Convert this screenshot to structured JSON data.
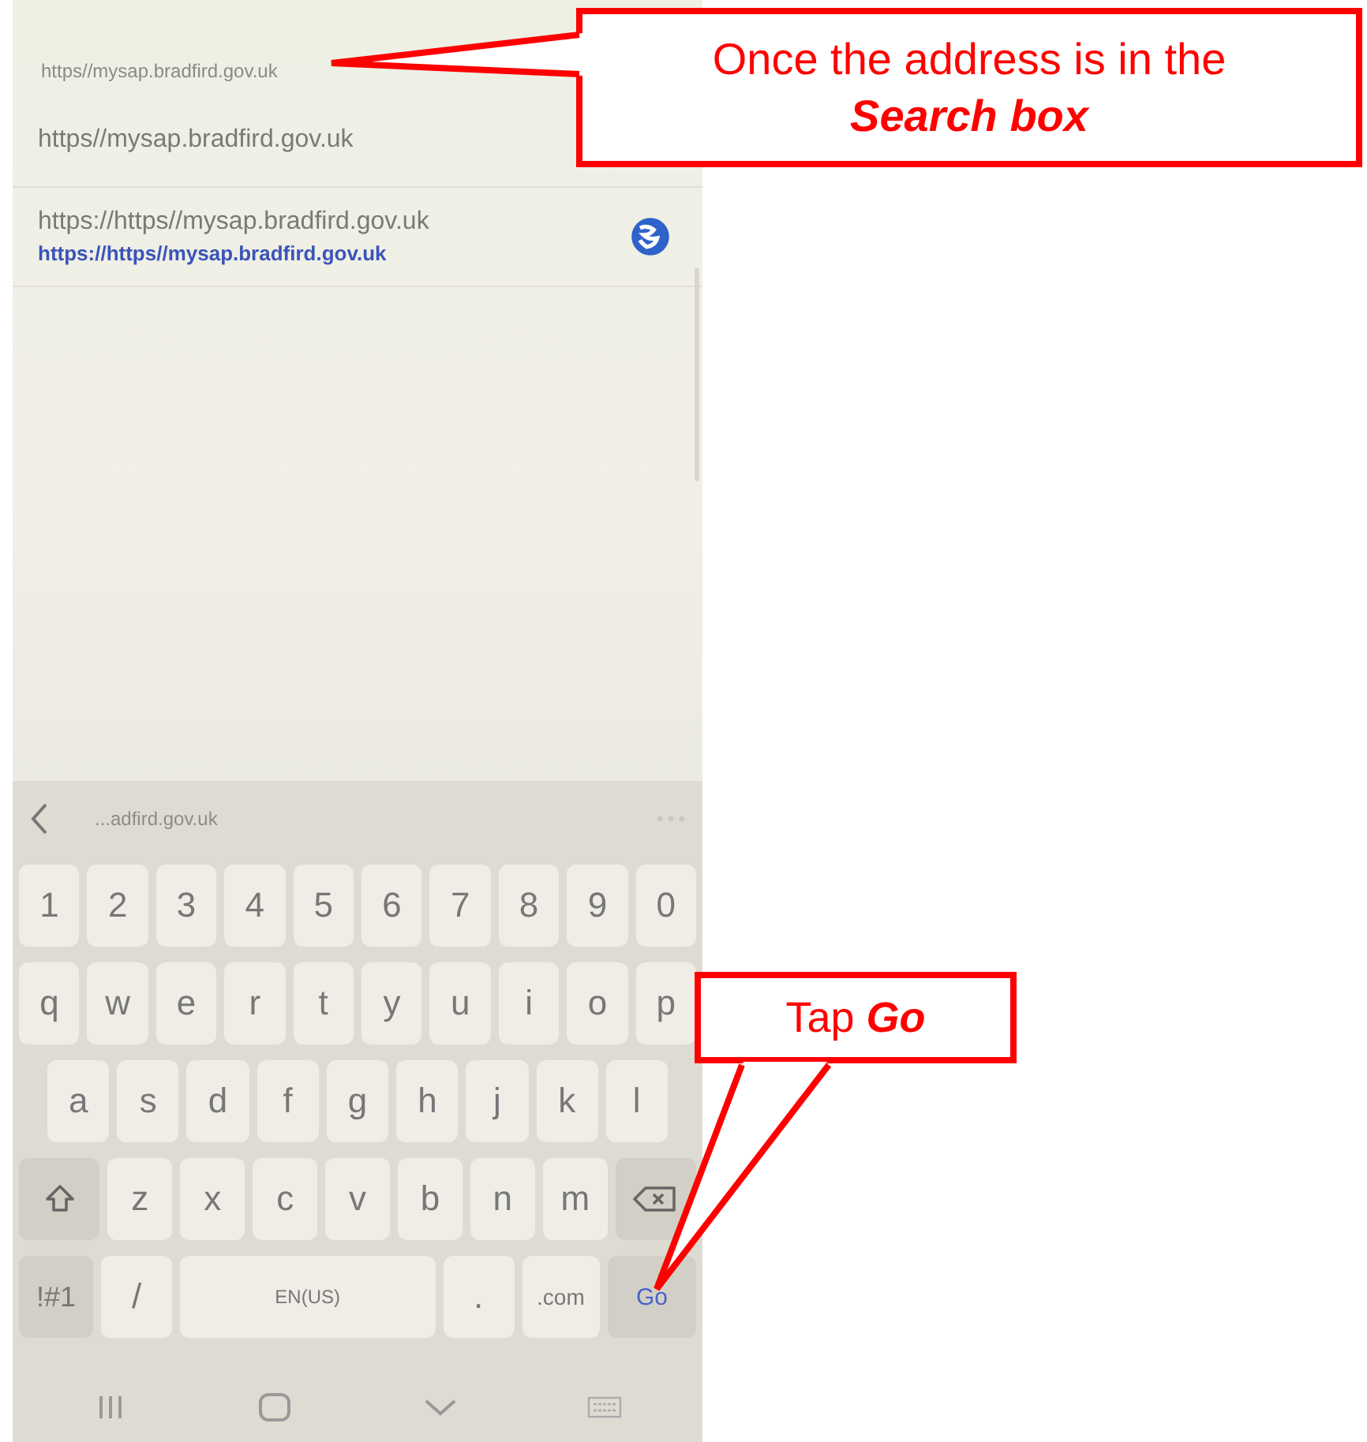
{
  "address_bar": {
    "value": "https//mysap.bradfird.gov.uk"
  },
  "suggestions": [
    {
      "kind": "history",
      "title": "https//mysap.bradfird.gov.uk"
    },
    {
      "kind": "web",
      "title": "https://https//mysap.bradfird.gov.uk",
      "url": "https://https//mysap.bradfird.gov.uk"
    }
  ],
  "keyboard": {
    "prediction": "...adfird.gov.uk",
    "rows": [
      {
        "kind": "numbers",
        "keys": [
          {
            "kind": "char",
            "label": "1"
          },
          {
            "kind": "char",
            "label": "2"
          },
          {
            "kind": "char",
            "label": "3"
          },
          {
            "kind": "char",
            "label": "4"
          },
          {
            "kind": "char",
            "label": "5"
          },
          {
            "kind": "char",
            "label": "6"
          },
          {
            "kind": "char",
            "label": "7"
          },
          {
            "kind": "char",
            "label": "8"
          },
          {
            "kind": "char",
            "label": "9"
          },
          {
            "kind": "char",
            "label": "0"
          }
        ]
      },
      {
        "kind": "letters",
        "keys": [
          {
            "kind": "char",
            "label": "q"
          },
          {
            "kind": "char",
            "label": "w"
          },
          {
            "kind": "char",
            "label": "e"
          },
          {
            "kind": "char",
            "label": "r"
          },
          {
            "kind": "char",
            "label": "t"
          },
          {
            "kind": "char",
            "label": "y"
          },
          {
            "kind": "char",
            "label": "u"
          },
          {
            "kind": "char",
            "label": "i"
          },
          {
            "kind": "char",
            "label": "o"
          },
          {
            "kind": "char",
            "label": "p"
          }
        ]
      },
      {
        "kind": "inset",
        "keys": [
          {
            "kind": "char",
            "label": "a"
          },
          {
            "kind": "char",
            "label": "s"
          },
          {
            "kind": "char",
            "label": "d"
          },
          {
            "kind": "char",
            "label": "f"
          },
          {
            "kind": "char",
            "label": "g"
          },
          {
            "kind": "char",
            "label": "h"
          },
          {
            "kind": "char",
            "label": "j"
          },
          {
            "kind": "char",
            "label": "k"
          },
          {
            "kind": "char",
            "label": "l"
          }
        ]
      },
      {
        "kind": "letters",
        "keys": [
          {
            "kind": "shift"
          },
          {
            "kind": "char",
            "label": "z"
          },
          {
            "kind": "char",
            "label": "x"
          },
          {
            "kind": "char",
            "label": "c"
          },
          {
            "kind": "char",
            "label": "v"
          },
          {
            "kind": "char",
            "label": "b"
          },
          {
            "kind": "char",
            "label": "n"
          },
          {
            "kind": "char",
            "label": "m"
          },
          {
            "kind": "backspace"
          }
        ]
      },
      {
        "kind": "bottom",
        "keys": [
          {
            "kind": "symbols",
            "label": "!#1"
          },
          {
            "kind": "char",
            "label": "/"
          },
          {
            "kind": "space",
            "label": "EN(US)"
          },
          {
            "kind": "char",
            "label": "."
          },
          {
            "kind": "domain",
            "label": ".com"
          },
          {
            "kind": "go",
            "label": "Go"
          }
        ]
      }
    ]
  },
  "callouts": [
    {
      "text": "Once the address is in the **Search box**"
    },
    {
      "text": "Tap **Go**"
    }
  ]
}
